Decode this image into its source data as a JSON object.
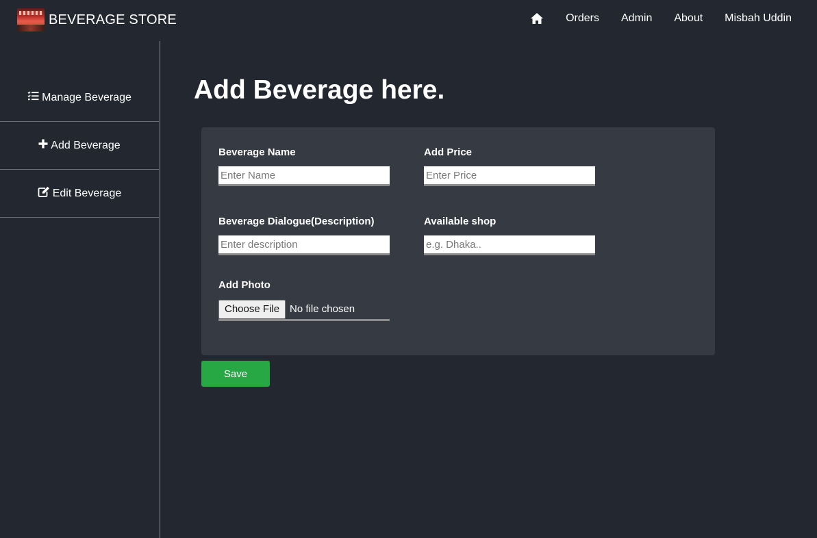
{
  "navbar": {
    "brand_text": "BEVERAGE STORE",
    "links": [
      "Orders",
      "Admin",
      "About",
      "Misbah Uddin"
    ],
    "home_icon": "home-icon"
  },
  "sidebar": {
    "items": [
      {
        "label": "Manage Beverage",
        "icon": "checklist-icon"
      },
      {
        "label": "Add Beverage",
        "icon": "plus-icon"
      },
      {
        "label": "Edit Beverage",
        "icon": "edit-icon"
      }
    ]
  },
  "main": {
    "title": "Add Beverage here.",
    "form": {
      "name_label": "Beverage Name",
      "name_placeholder": "Enter Name",
      "price_label": "Add Price",
      "price_placeholder": "Enter Price",
      "description_label": "Beverage Dialogue(Description)",
      "description_placeholder": "Enter description",
      "shop_label": "Available shop",
      "shop_placeholder": "e.g. Dhaka..",
      "photo_label": "Add Photo",
      "file_button": "Choose File",
      "file_status": "No file chosen"
    },
    "save_label": "Save"
  },
  "colors": {
    "background": "#23272f",
    "card": "#363a43",
    "save_button": "#28a745"
  }
}
